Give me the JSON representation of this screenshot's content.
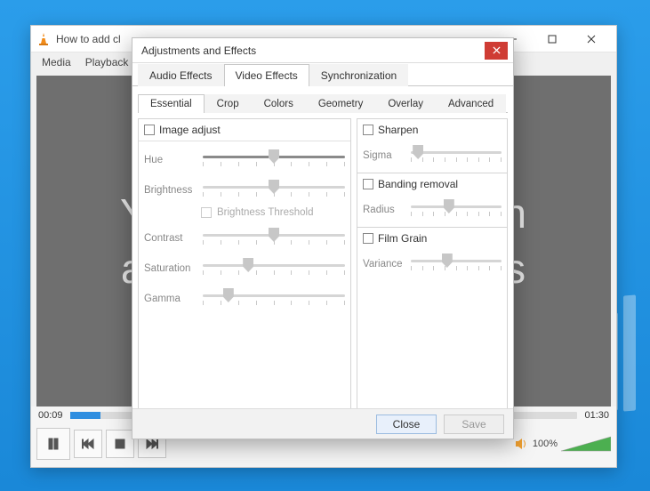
{
  "vlc": {
    "title": "How to add cl",
    "menubar": [
      "Media",
      "Playback"
    ],
    "video_text_line1": "Y",
    "video_text_line2": "ap",
    "video_text_right1": "n",
    "video_text_right2": "ws",
    "time_elapsed": "00:09",
    "time_total": "01:30",
    "volume_label": "100%"
  },
  "dialog": {
    "title": "Adjustments and Effects",
    "tabs": [
      "Audio Effects",
      "Video Effects",
      "Synchronization"
    ],
    "active_tab": 1,
    "subtabs": [
      "Essential",
      "Crop",
      "Colors",
      "Geometry",
      "Overlay",
      "Advanced"
    ],
    "active_subtab": 0,
    "left": {
      "group": "Image adjust",
      "sliders": [
        {
          "label": "Hue",
          "pos": 50
        },
        {
          "label": "Brightness",
          "pos": 50
        },
        {
          "label": "Contrast",
          "pos": 50
        },
        {
          "label": "Saturation",
          "pos": 32
        },
        {
          "label": "Gamma",
          "pos": 18
        }
      ],
      "threshold_label": "Brightness Threshold"
    },
    "right": [
      {
        "title": "Sharpen",
        "slider_label": "Sigma",
        "pos": 8
      },
      {
        "title": "Banding removal",
        "slider_label": "Radius",
        "pos": 42
      },
      {
        "title": "Film Grain",
        "slider_label": "Variance",
        "pos": 40
      }
    ],
    "buttons": {
      "close": "Close",
      "save": "Save"
    }
  }
}
